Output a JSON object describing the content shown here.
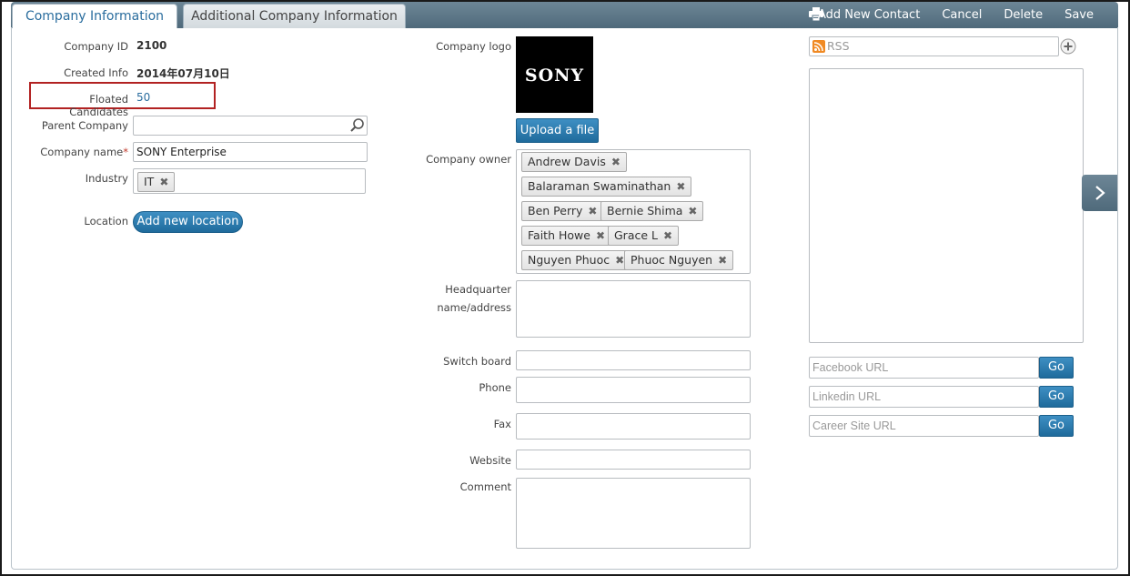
{
  "tabs": [
    {
      "label": "Company Information"
    },
    {
      "label": "Additional Company Information"
    }
  ],
  "actions": {
    "add_new_contact": "Add New Contact",
    "cancel": "Cancel",
    "delete": "Delete",
    "save": "Save"
  },
  "left": {
    "company_id_label": "Company ID",
    "company_id_value": "2100",
    "created_info_label": "Created Info",
    "created_info_value": "2014年07月10日",
    "floated_label": "Floated Candidates",
    "floated_value": "50",
    "parent_company_label": "Parent Company",
    "parent_company_value": "",
    "company_name_label": "Company name",
    "company_name_required": "*",
    "company_name_value": "SONY Enterprise",
    "industry_label": "Industry",
    "industry_tags": [
      "IT"
    ],
    "location_label": "Location",
    "add_location_button": "Add new location"
  },
  "middle": {
    "logo_label": "Company logo",
    "logo_text": "SONY",
    "upload_button": "Upload a file",
    "owner_label": "Company owner",
    "owners": [
      "Andrew Davis",
      "Balaraman Swaminathan",
      "Ben Perry",
      "Bernie Shima",
      "Faith Howe",
      "Grace L",
      "Nguyen Phuoc",
      "Phuoc Nguyen"
    ],
    "hq_label_1": "Headquarter",
    "hq_label_2": "name/address",
    "switchboard_label": "Switch board",
    "phone_label": "Phone",
    "fax_label": "Fax",
    "website_label": "Website",
    "comment_label": "Comment"
  },
  "right": {
    "rss_placeholder": "RSS",
    "facebook_placeholder": "Facebook URL",
    "linkedin_placeholder": "Linkedin URL",
    "career_placeholder": "Career Site URL",
    "go_label": "Go"
  },
  "colors": {
    "accent_blue": "#2a6d9e",
    "button_blue": "#1f6b9c",
    "highlight_red": "#b22222",
    "topbar": "#5c7788"
  }
}
